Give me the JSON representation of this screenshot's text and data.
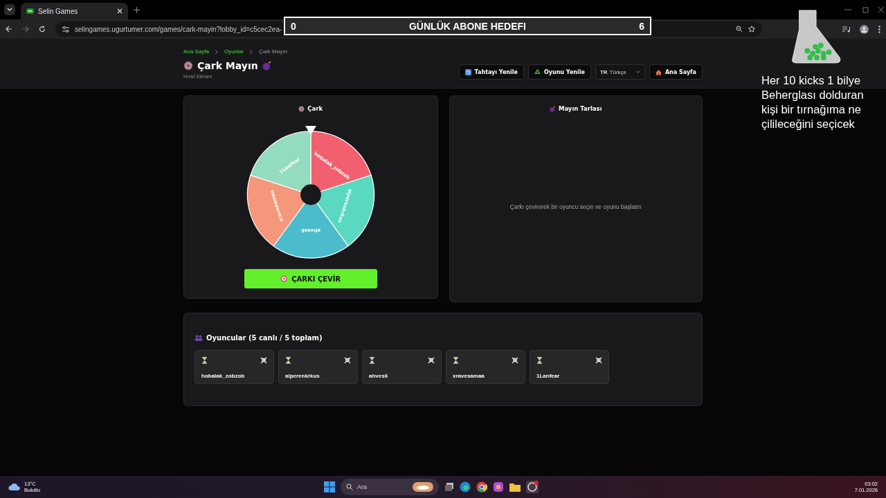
{
  "browser": {
    "tab_title": "Selin Games",
    "url": "selingames.ugurtumer.com/games/cark-mayin?lobby_id=c5cec2ea-"
  },
  "overlay": {
    "goal_start": "0",
    "goal_label": "GÜNLÜK ABONE HEDEFI",
    "goal_end": "6",
    "note": "Her 10 kicks 1 bilye Beherglası dolduran kişi bir tırnağıma ne çilileceğini seçicek"
  },
  "breadcrumb": [
    {
      "label": "Ana Sayfa",
      "current": false
    },
    {
      "label": "Oyunlar",
      "current": false
    },
    {
      "label": "Çark Mayın",
      "current": true
    }
  ],
  "header": {
    "title": "Çark Mayın",
    "subtitle": "Host Ekranı"
  },
  "actions": [
    {
      "kind": "board-refresh",
      "label": "Tahtayı Yenile"
    },
    {
      "kind": "game-refresh",
      "label": "Oyunu Yenile"
    },
    {
      "kind": "language",
      "code": "TR",
      "label": "Türkçe"
    },
    {
      "kind": "home",
      "label": "Ana Sayfa"
    }
  ],
  "wheel_panel": {
    "title": "Çark",
    "spin_button": "ÇARKI ÇEVİR",
    "segments": [
      {
        "label": "hobalak_zobzob",
        "color": "#f25f6e"
      },
      {
        "label": "alperenkrkus",
        "color": "#5ad8c0"
      },
      {
        "label": "ahves6",
        "color": "#4bbccb"
      },
      {
        "label": "xravesamaa",
        "color": "#f4977a"
      },
      {
        "label": "1Lanfear",
        "color": "#93dcc0"
      }
    ]
  },
  "mine_panel": {
    "title": "Mayın Tarlası",
    "message": "Çarkı çevirerek bir oyuncu seçin ve oyunu başlatın"
  },
  "players": {
    "title": "Oyuncular (5 canlı / 5 toplam)",
    "items": [
      {
        "name": "hobalak_zobzob"
      },
      {
        "name": "alperenkrkus"
      },
      {
        "name": "ahves6"
      },
      {
        "name": "xravesamaa"
      },
      {
        "name": "1Lanfear"
      }
    ]
  },
  "taskbar": {
    "temperature": "13°C",
    "condition": "Bulutlu",
    "search_placeholder": "Ara",
    "time": "03:02",
    "date": "7.01.2026"
  }
}
